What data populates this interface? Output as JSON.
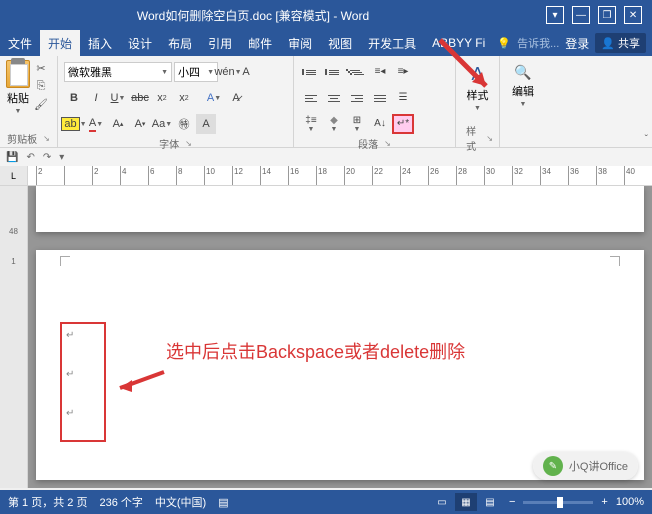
{
  "titlebar": {
    "title": "Word如何删除空白页.doc [兼容模式] - Word"
  },
  "menu": {
    "file": "文件",
    "home": "开始",
    "insert": "插入",
    "design": "设计",
    "layout": "布局",
    "references": "引用",
    "mailings": "邮件",
    "review": "审阅",
    "view": "视图",
    "developer": "开发工具",
    "abbyy": "ABBYY Fi",
    "tellme": "告诉我...",
    "signin": "登录",
    "share": "共享"
  },
  "ribbon": {
    "clipboard": {
      "label": "剪贴板",
      "paste": "粘贴"
    },
    "font": {
      "label": "字体",
      "name": "微软雅黑",
      "size": "小四"
    },
    "paragraph": {
      "label": "段落"
    },
    "styles": {
      "label": "样式",
      "btn": "样式"
    },
    "editing": {
      "label": "编辑",
      "btn": "编辑"
    }
  },
  "ruler_corner": "L",
  "hruler": [
    "2",
    "",
    "2",
    "4",
    "6",
    "8",
    "10",
    "12",
    "14",
    "16",
    "18",
    "20",
    "22",
    "24",
    "26",
    "28",
    "30",
    "32",
    "34",
    "36",
    "38",
    "40"
  ],
  "vruler": [
    "",
    "48",
    "1"
  ],
  "page2": {
    "instruction": "选中后点击Backspace或者delete删除",
    "paramarks": [
      "↵",
      "↵",
      "↵"
    ]
  },
  "status": {
    "page": "第 1 页，共 2 页",
    "words": "236 个字",
    "lang": "中文(中国)",
    "zoom": "100%"
  },
  "watermark": "小Q讲Office"
}
